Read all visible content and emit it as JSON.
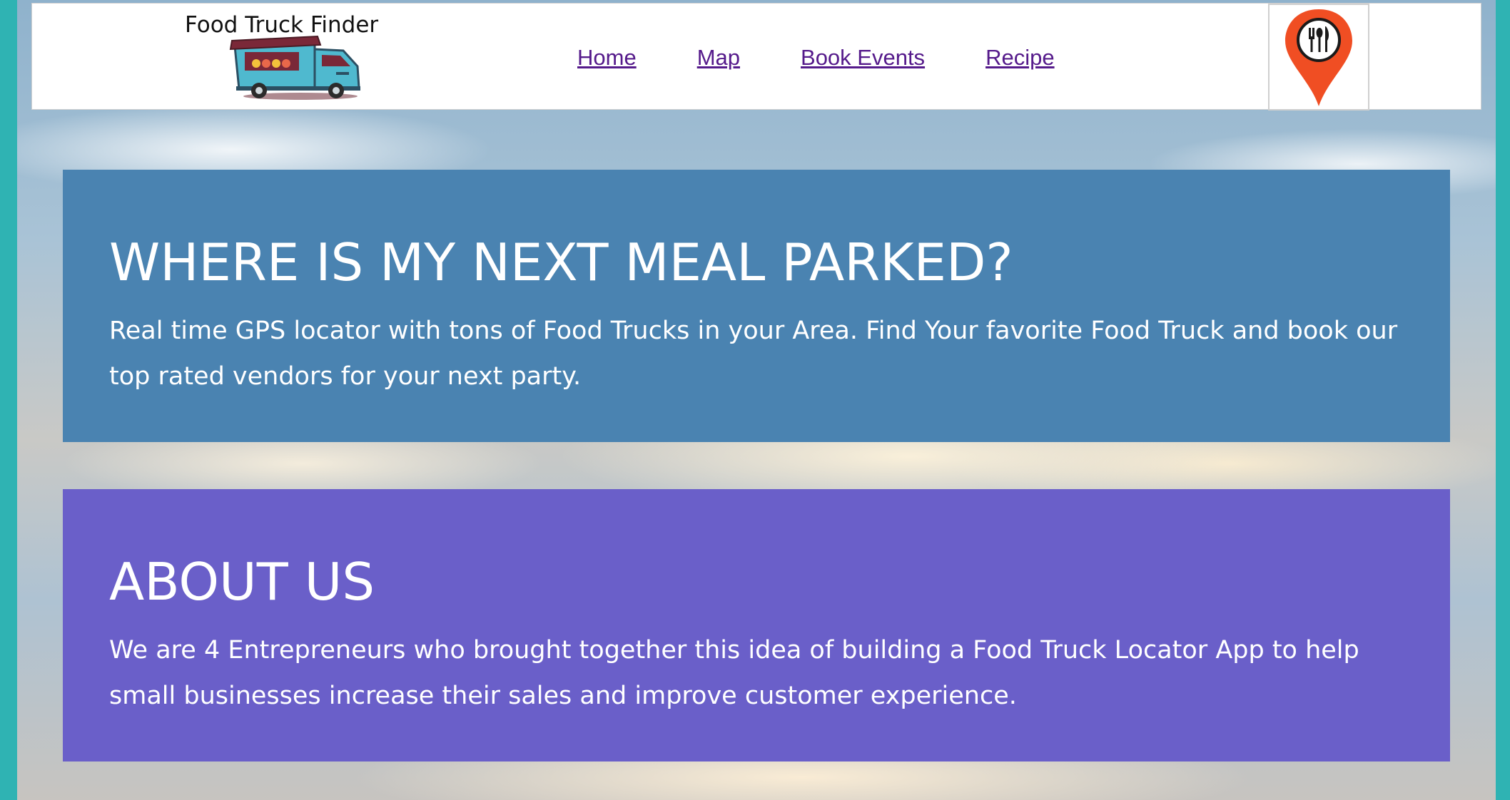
{
  "header": {
    "brand_title": "Food Truck Finder",
    "nav": [
      "Home",
      "Map",
      "Book Events",
      "Recipe"
    ]
  },
  "hero": {
    "heading": "WHERE IS MY NEXT MEAL PARKED?",
    "text": "Real time GPS locator with tons of Food Trucks in your Area. Find Your favorite Food Truck and book our top rated vendors for your next party."
  },
  "about": {
    "heading": "ABOUT US",
    "text": "We are 4 Entrepreneurs who brought together this idea of building a Food Truck Locator App to help small businesses increase their sales and improve customer experience."
  },
  "icons": {
    "brand_logo": "food-truck-icon",
    "location_pin": "map-pin-utensils-icon"
  },
  "colors": {
    "hero_panel": "#4a83b1",
    "about_panel": "#6a5fc9",
    "page_border": "#2fb3b3",
    "nav_link": "#551a8b",
    "pin": "#f04e23"
  }
}
